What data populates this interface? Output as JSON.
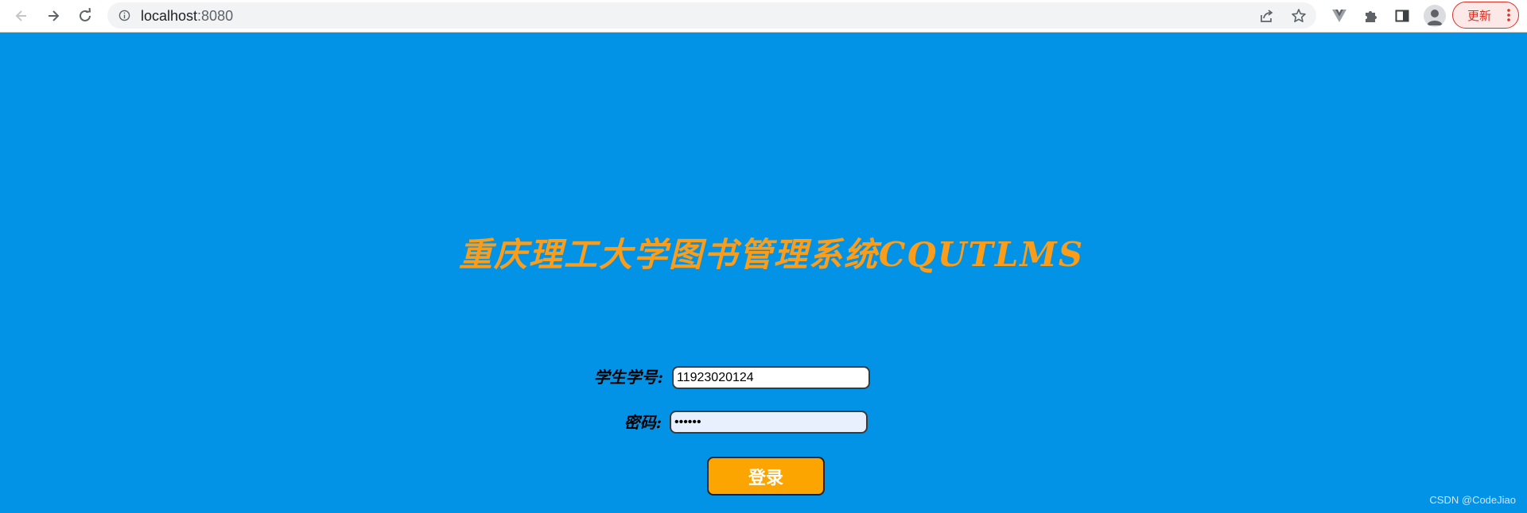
{
  "browser": {
    "url_host": "localhost",
    "url_port": ":8080",
    "update_label": "更新"
  },
  "icons": {
    "back": "back-arrow-icon",
    "forward": "forward-arrow-icon",
    "reload": "reload-icon",
    "info": "info-icon",
    "share": "share-icon",
    "bookmark": "star-icon",
    "vue_devtools": "vue-devtools-icon",
    "extensions": "puzzle-icon",
    "side_panel": "side-panel-icon",
    "profile": "avatar-icon",
    "menu": "kebab-menu-icon"
  },
  "login": {
    "title": "重庆理工大学图书管理系统CQUTLMS",
    "student_id_label": "学生学号:",
    "student_id_value": "11923020124",
    "password_label": "密码:",
    "password_value": "••••••",
    "submit_label": "登录"
  },
  "watermark": "CSDN @CodeJiao",
  "colors": {
    "page_background": "#0293e7",
    "title": "#fc9d1a",
    "button": "#fca500",
    "update_accent": "#d93025"
  }
}
